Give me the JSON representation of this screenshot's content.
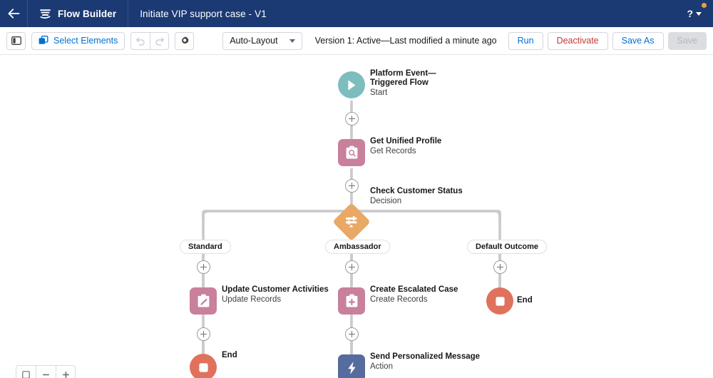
{
  "header": {
    "back_icon": "arrow-left-icon",
    "app_icon": "flow-builder-logo-icon",
    "app_name": "Flow Builder",
    "flow_title": "Initiate VIP support case - V1",
    "help_label": "?",
    "help_icon": "question-mark-icon",
    "notification_dot_color": "#e8a33d",
    "bg_color": "#1b3a73"
  },
  "toolbar": {
    "panel_toggle_icon": "toggle-left-panel-icon",
    "select_elements_label": "Select Elements",
    "select_elements_icon": "select-elements-icon",
    "undo_icon": "undo-icon",
    "redo_icon": "redo-icon",
    "settings_icon": "gear-icon",
    "layout_value": "Auto-Layout",
    "version_status": "Version 1: Active—Last modified a minute ago",
    "run_label": "Run",
    "deactivate_label": "Deactivate",
    "save_as_label": "Save As",
    "save_label": "Save",
    "deactivate_color": "#c23934",
    "link_color": "#0070d2"
  },
  "canvas": {
    "zoom_controls": [
      "zoom-to-fit-icon",
      "zoom-out-icon",
      "zoom-in-icon"
    ],
    "nodes": [
      {
        "id": "start",
        "title": "Platform Event—Triggered Flow",
        "subtitle": "Start",
        "shape": "circle",
        "icon": "play-icon",
        "color": "#7dbdbd"
      },
      {
        "id": "get-unified-profile",
        "title": "Get Unified Profile",
        "subtitle": "Get Records",
        "shape": "square",
        "icon": "clipboard-search-icon",
        "color": "#c8809c"
      },
      {
        "id": "check-customer-status",
        "title": "Check Customer Status",
        "subtitle": "Decision",
        "shape": "diamond",
        "icon": "decision-sliders-icon",
        "color": "#e9a košice"
      },
      {
        "id": "update-customer-activities",
        "title": "Update Customer Activities",
        "subtitle": "Update Records",
        "shape": "square",
        "icon": "clipboard-pencil-icon",
        "color": "#c8809c"
      },
      {
        "id": "create-escalated-case",
        "title": "Create Escalated Case",
        "subtitle": "Create Records",
        "shape": "square",
        "icon": "clipboard-plus-icon",
        "color": "#c8809c"
      },
      {
        "id": "end-default",
        "title": "End",
        "subtitle": "",
        "shape": "circle",
        "icon": "stop-square-icon",
        "color": "#e0715c"
      },
      {
        "id": "end-standard",
        "title": "End",
        "subtitle": "",
        "shape": "circle",
        "icon": "stop-square-icon",
        "color": "#e0715c"
      },
      {
        "id": "send-personalized-message",
        "title": "Send Personalized Message",
        "subtitle": "Action",
        "shape": "square",
        "icon": "lightning-bolt-icon",
        "color": "#566c9e"
      }
    ],
    "branches": [
      {
        "id": "standard",
        "label": "Standard"
      },
      {
        "id": "ambassador",
        "label": "Ambassador"
      },
      {
        "id": "default-outcome",
        "label": "Default Outcome"
      }
    ],
    "add_buttons": 7,
    "connector_color": "#c9cacd"
  }
}
